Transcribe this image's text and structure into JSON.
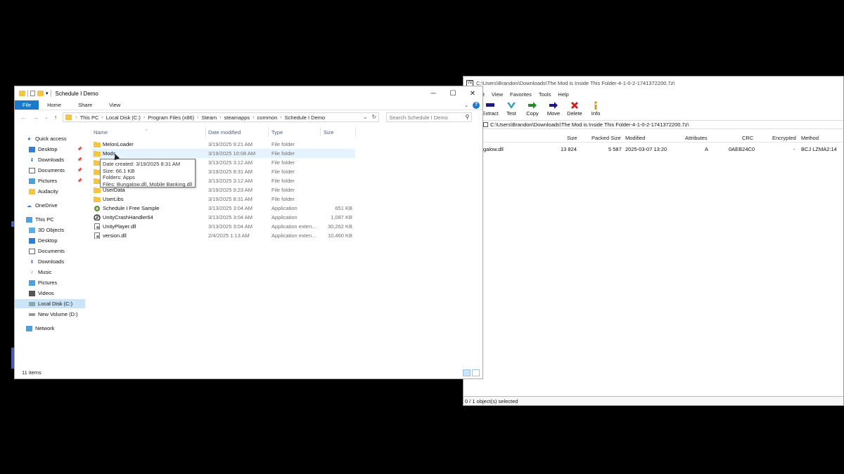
{
  "zip": {
    "title": "C:\\Users\\Brandon\\Downloads\\The Mod is Inside This Folder-4-1-0-2-1741372200.7z\\",
    "app_icon": "7z",
    "menu": [
      "dit",
      "View",
      "Favorites",
      "Tools",
      "Help"
    ],
    "toolbar": [
      {
        "label": "Extract",
        "icon": "extract-icon",
        "color": "#1a1a8c"
      },
      {
        "label": "Test",
        "icon": "test-icon",
        "color": "#2aa0b8"
      },
      {
        "label": "Copy",
        "icon": "copy-icon",
        "color": "#2a8a2a"
      },
      {
        "label": "Move",
        "icon": "move-icon",
        "color": "#1a1a8c"
      },
      {
        "label": "Delete",
        "icon": "delete-icon",
        "color": "#d02020"
      },
      {
        "label": "Info",
        "icon": "info-icon",
        "color": "#c8a020"
      }
    ],
    "address": "C:\\Users\\Brandon\\Downloads\\The Mod is Inside This Folder-4-1-0-2-1741372200.7z\\",
    "columns": {
      "size": "Size",
      "packed": "Packed Size",
      "modified": "Modified",
      "attributes": "Attributes",
      "crc": "CRC",
      "encrypted": "Encrypted",
      "method": "Method"
    },
    "row": {
      "name": "galow.dll",
      "size": "13 824",
      "packed": "5 587",
      "modified": "2025-03-07 13:20",
      "attributes": "A",
      "crc": "0AEB24C0",
      "encrypted": "-",
      "method": "BCJ LZMA2:14"
    },
    "status": "0 / 1 object(s) selected"
  },
  "explorer": {
    "title": "Schedule I Demo",
    "window_controls": {
      "minimize": "─",
      "maximize": "☐",
      "close": "✕"
    },
    "ribbon": {
      "file": "File",
      "home": "Home",
      "share": "Share",
      "view": "View",
      "help": "?"
    },
    "nav": {
      "back": "←",
      "forward": "→",
      "recent": "⌄",
      "up": "↑"
    },
    "breadcrumbs": [
      "This PC",
      "Local Disk (C:)",
      "Program Files (x86)",
      "Steam",
      "steamapps",
      "common",
      "Schedule I Demo"
    ],
    "search_placeholder": "Search Schedule I Demo",
    "navpane": [
      {
        "label": "Quick access",
        "icon": "star-icon",
        "pinned": false,
        "sel": false
      },
      {
        "label": "Desktop",
        "icon": "desktop-icon",
        "pinned": true,
        "sel": false
      },
      {
        "label": "Downloads",
        "icon": "downloads-icon",
        "pinned": true,
        "sel": false
      },
      {
        "label": "Documents",
        "icon": "documents-icon",
        "pinned": true,
        "sel": false
      },
      {
        "label": "Pictures",
        "icon": "pictures-icon",
        "pinned": true,
        "sel": false
      },
      {
        "label": "Audacity",
        "icon": "folder-icon",
        "pinned": false,
        "sel": false
      },
      {
        "label": "OneDrive",
        "icon": "cloud-icon",
        "pinned": false,
        "sel": false
      },
      {
        "label": "This PC",
        "icon": "computer-icon",
        "pinned": false,
        "sel": false
      },
      {
        "label": "3D Objects",
        "icon": "cube-icon",
        "pinned": false,
        "sel": false
      },
      {
        "label": "Desktop",
        "icon": "desktop-icon",
        "pinned": false,
        "sel": false
      },
      {
        "label": "Documents",
        "icon": "documents-icon",
        "pinned": false,
        "sel": false
      },
      {
        "label": "Downloads",
        "icon": "downloads-icon",
        "pinned": false,
        "sel": false
      },
      {
        "label": "Music",
        "icon": "music-icon",
        "pinned": false,
        "sel": false
      },
      {
        "label": "Pictures",
        "icon": "pictures-icon",
        "pinned": false,
        "sel": false
      },
      {
        "label": "Videos",
        "icon": "videos-icon",
        "pinned": false,
        "sel": false
      },
      {
        "label": "Local Disk (C:)",
        "icon": "drive-icon",
        "pinned": false,
        "sel": true
      },
      {
        "label": "New Volume (D:)",
        "icon": "drive-icon",
        "pinned": false,
        "sel": false
      },
      {
        "label": "Network",
        "icon": "network-icon",
        "pinned": false,
        "sel": false
      }
    ],
    "columns": {
      "name": "Name",
      "date": "Date modified",
      "type": "Type",
      "size": "Size"
    },
    "files": [
      {
        "name": "MelonLoader",
        "date": "3/19/2025 9:21 AM",
        "type": "File folder",
        "size": "",
        "icon": "folder-icon"
      },
      {
        "name": "Mods",
        "date": "3/19/2025 10:08 AM",
        "type": "File folder",
        "size": "",
        "icon": "folder-icon"
      },
      {
        "name": "",
        "date": "3/13/2025 3:12 AM",
        "type": "File folder",
        "size": "",
        "icon": "folder-icon"
      },
      {
        "name": "",
        "date": "3/19/2025 8:31 AM",
        "type": "File folder",
        "size": "",
        "icon": "folder-icon"
      },
      {
        "name": "",
        "date": "3/13/2025 3:12 AM",
        "type": "File folder",
        "size": "",
        "icon": "folder-icon"
      },
      {
        "name": "UserData",
        "date": "3/19/2025 9:23 AM",
        "type": "File folder",
        "size": "",
        "icon": "folder-icon"
      },
      {
        "name": "UserLibs",
        "date": "3/19/2025 8:31 AM",
        "type": "File folder",
        "size": "",
        "icon": "folder-icon"
      },
      {
        "name": "Schedule I Free Sample",
        "date": "3/13/2025 3:04 AM",
        "type": "Application",
        "size": "651 KB",
        "icon": "game-app-icon"
      },
      {
        "name": "UnityCrashHandler64",
        "date": "3/13/2025 3:04 AM",
        "type": "Application",
        "size": "1,087 KB",
        "icon": "unity-icon"
      },
      {
        "name": "UnityPlayer.dll",
        "date": "3/13/2025 3:04 AM",
        "type": "Application exten...",
        "size": "30,262 KB",
        "icon": "dll-icon"
      },
      {
        "name": "version.dll",
        "date": "2/4/2025 1:13 AM",
        "type": "Application exten...",
        "size": "10,460 KB",
        "icon": "dll-icon"
      }
    ],
    "tooltip": [
      "Date created: 3/19/2025 8:31 AM",
      "Size: 66.1 KB",
      "Folders: Apps",
      "Files: Bungalow.dll, Mobile Banking.dll"
    ],
    "status": "11 items",
    "colors": {
      "accent": "#1979ca",
      "folder": "#f5c441",
      "selected": "#cce4f7",
      "hover": "#e5f3ff"
    }
  }
}
